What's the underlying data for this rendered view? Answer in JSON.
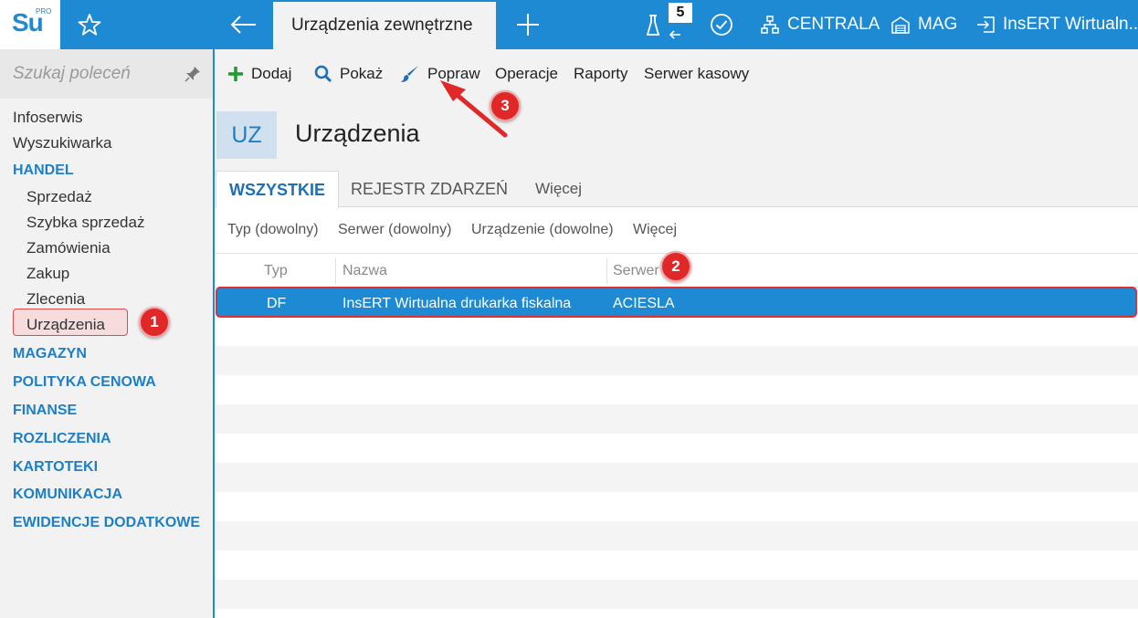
{
  "topbar": {
    "logo_text": "Su",
    "logo_sup": "PRO",
    "active_tab": "Urządzenia zewnętrzne",
    "badge_count": "5",
    "items": {
      "centrala": "CENTRALA",
      "mag": "MAG",
      "firm": "InsERT Wirtualn..."
    },
    "accent_color": "#1e8ad3"
  },
  "sidebar": {
    "search_placeholder": "Szukaj poleceń",
    "items": [
      {
        "label": "Infoserwis"
      },
      {
        "label": "Wyszukiwarka"
      },
      {
        "label": "HANDEL"
      },
      {
        "label": "Sprzedaż"
      },
      {
        "label": "Szybka sprzedaż"
      },
      {
        "label": "Zamówienia"
      },
      {
        "label": "Zakup"
      },
      {
        "label": "Zlecenia"
      },
      {
        "label": "Urządzenia"
      },
      {
        "label": "MAGAZYN"
      },
      {
        "label": "POLITYKA CENOWA"
      },
      {
        "label": "FINANSE"
      },
      {
        "label": "ROZLICZENIA"
      },
      {
        "label": "KARTOTEKI"
      },
      {
        "label": "KOMUNIKACJA"
      },
      {
        "label": "EWIDENCJE DODATKOWE"
      }
    ]
  },
  "toolbar": {
    "add": "Dodaj",
    "show": "Pokaż",
    "edit": "Popraw",
    "operations": "Operacje",
    "reports": "Raporty",
    "cash_server": "Serwer kasowy"
  },
  "header": {
    "tile": "UZ",
    "title": "Urządzenia"
  },
  "tabs": {
    "all": "WSZYSTKIE",
    "events": "REJESTR ZDARZEŃ",
    "more": "Więcej"
  },
  "filters": {
    "type": "Typ (dowolny)",
    "server": "Serwer (dowolny)",
    "device": "Urządzenie (dowolne)",
    "more": "Więcej"
  },
  "table": {
    "columns": [
      "Typ",
      "Nazwa",
      "Serwer"
    ],
    "rows": [
      [
        "DF",
        "InsERT Wirtualna drukarka fiskalna",
        "ACIESLA"
      ]
    ]
  },
  "annotations": {
    "a1": "1",
    "a2": "2",
    "a3": "3",
    "color": "#e02828"
  }
}
